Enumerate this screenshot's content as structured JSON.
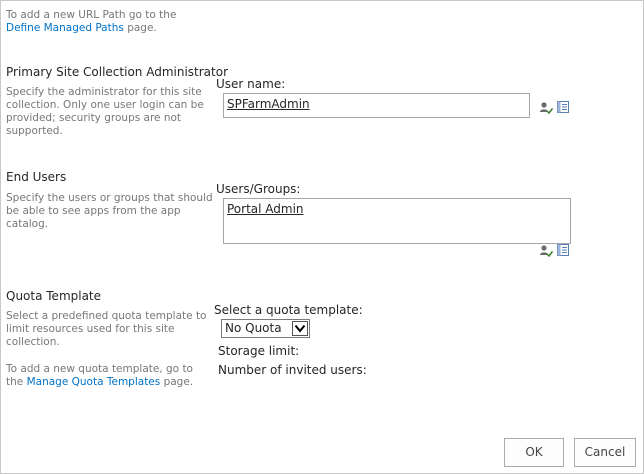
{
  "url_path_note": {
    "text": "To add a new URL Path go to the",
    "link": "Define Managed Paths",
    "suffix": " page."
  },
  "primary_admin": {
    "heading": "Primary Site Collection Administrator",
    "description_lines": [
      "Specify the administrator for this site",
      "collection. Only one user login can be",
      "provided; security groups are not",
      "supported."
    ],
    "field_label": "User name:",
    "value": "SPFarmAdmin"
  },
  "end_users": {
    "heading": "End Users",
    "description_lines": [
      "Specify the users or groups that should",
      "be able to see apps from the app",
      "catalog."
    ],
    "field_label": "Users/Groups:",
    "value": "Portal Admin"
  },
  "quota": {
    "heading": "Quota Template",
    "description_lines": [
      "Select a predefined quota template to",
      "limit resources used for this site",
      "collection."
    ],
    "add_note_line1": "To add a new quota template, go to",
    "add_note_prefix": "the ",
    "add_note_link": "Manage Quota Templates",
    "add_note_suffix": " page.",
    "select_label": "Select a quota template:",
    "selected": "No Quota",
    "storage_label": "Storage limit:",
    "invited_label": "Number of invited users:"
  },
  "buttons": {
    "ok": "OK",
    "cancel": "Cancel"
  },
  "icons": {
    "check_names": "check-names-icon",
    "browse": "address-book-icon"
  }
}
